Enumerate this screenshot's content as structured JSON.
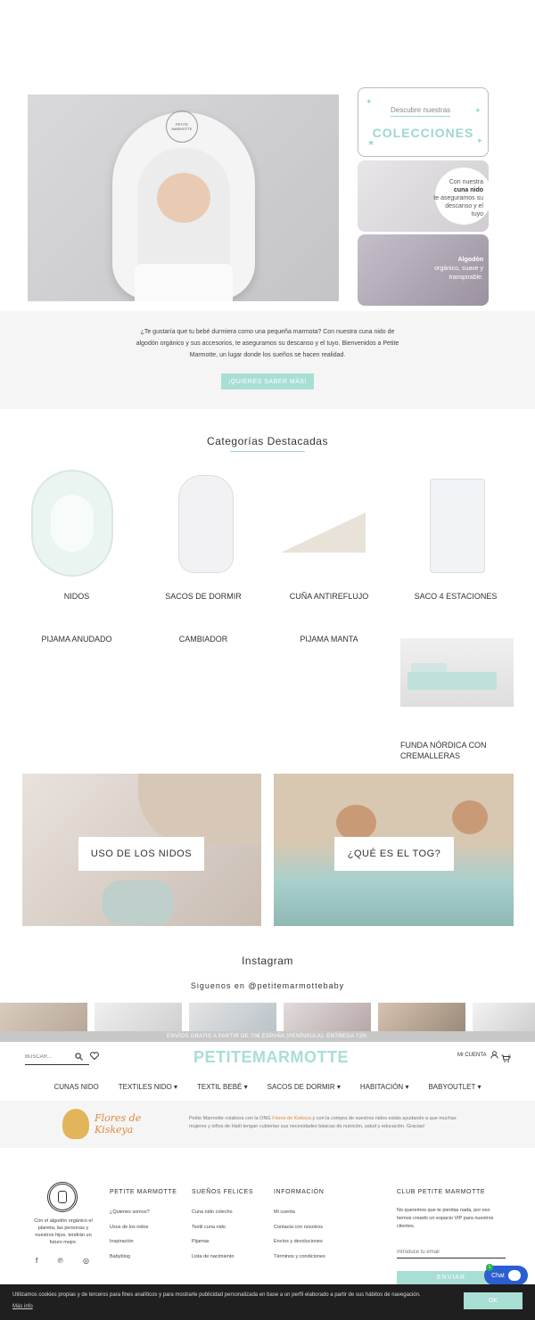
{
  "hero": {
    "logo_text": "PETITE MARMOTTE",
    "discover": "Descubre nuestras",
    "collections": "COLECCIONES",
    "side2_line1": "Con nuestra",
    "side2_bold": "cuna nido",
    "side2_line2": "te aseguramos su descanso y el tuyo",
    "side3_bold": "Algodón",
    "side3_rest": "orgánico, suave y transpirable."
  },
  "intro": {
    "text": "¿Te gustaría que tu bebé durmiera como una pequeña marmota? Con nuestra cuna nido de algodón orgánico y sus accesorios, te aseguramos su descanso y el tuyo. Bienvenidos a Petite Marmotte, un lugar donde los sueños se hacen realidad.",
    "button": "¡QUIERES SABER MÁS!"
  },
  "categories": {
    "title": "Categorías Destacadas",
    "items": [
      {
        "label": "NIDOS"
      },
      {
        "label": "SACOS DE DORMIR"
      },
      {
        "label": "CUÑA ANTIREFLUJO"
      },
      {
        "label": "SACO 4 ESTACIONES"
      },
      {
        "label": "PIJAMA ANUDADO"
      },
      {
        "label": "CAMBIADOR"
      },
      {
        "label": "PIJAMA MANTA"
      },
      {
        "label": "FUNDA NÓRDICA CON CREMALLERAS"
      }
    ]
  },
  "banners": [
    {
      "label": "USO DE LOS NIDOS"
    },
    {
      "label": "¿QUÉ ES EL TOG?"
    }
  ],
  "instagram": {
    "title": "Instagram",
    "subtitle": "Siguenos en @petitemarmottebaby"
  },
  "topbar": {
    "text": "ENVÍOS GRATIS A PARTIR DE 70€ ESPAÑA (PENÍNSULA). ENTREGA 72H."
  },
  "header": {
    "search_placeholder": "BUSCAR...",
    "brand": "PETITEMARMOTTE",
    "account": "MI CUENTA",
    "cart_count": "0"
  },
  "nav": [
    {
      "label": "CUNAS NIDO",
      "caret": ""
    },
    {
      "label": "TEXTILES NIDO",
      "caret": "▾"
    },
    {
      "label": "TEXTIL BEBÉ",
      "caret": "▾"
    },
    {
      "label": "SACOS DE DORMIR",
      "caret": "▾"
    },
    {
      "label": "HABITACIÓN",
      "caret": "▾"
    },
    {
      "label": "BABYOUTLET",
      "caret": "▾"
    }
  ],
  "ngo": {
    "logo_text": "Flores de Kiskeya",
    "text_a": "Petite Marmotte colabora con la ONG ",
    "link": "Flores de Kiskeya",
    "text_b": " y con la compra de vuestros nidos estáis ayudando a que muchas mujeres y niños de Haití tengan cubiertas sus necesidades básicas de nutrición, salud y educación. Gracias!"
  },
  "footer": {
    "about": "Con el algodón orgánico el planeta, las personas y nuestros hijos, tendrán un futuro mejor.",
    "col1": {
      "title": "PETITE MARMOTTE",
      "links": [
        "¿Quienes somos?",
        "Usos de los nidos",
        "Inspiración",
        "Babyblog"
      ]
    },
    "col2": {
      "title": "SUEÑOS FELICES",
      "links": [
        "Cuna nido colecho",
        "Textil cuna nido",
        "Pijamas",
        "Lista de nacimiento"
      ]
    },
    "col3": {
      "title": "INFORMACIÓN",
      "links": [
        "Mi cuenta",
        "Contacta con nosotros",
        "Envíos y devoluciones",
        "Términos y condiciones"
      ]
    },
    "club": {
      "title": "CLUB PETITE MARMOTTE",
      "text": "No queremos que te pierdas nada, por eso hemos creado un espacio VIP para nuestros clientes.",
      "email_placeholder": "Introduce tu email",
      "button": "ENVIAR"
    }
  },
  "cookie": {
    "text": "Utilizamos cookies propias y de terceros para fines analíticos y para mostrarle publicidad personalizada en base a un perfil elaborado a partir de sus hábitos de navegación.",
    "link": "Más info",
    "ok": "OK"
  },
  "chat": {
    "label": "Chat",
    "badge": "1"
  },
  "colors": {
    "accent": "#a9ded5",
    "text": "#333333"
  }
}
